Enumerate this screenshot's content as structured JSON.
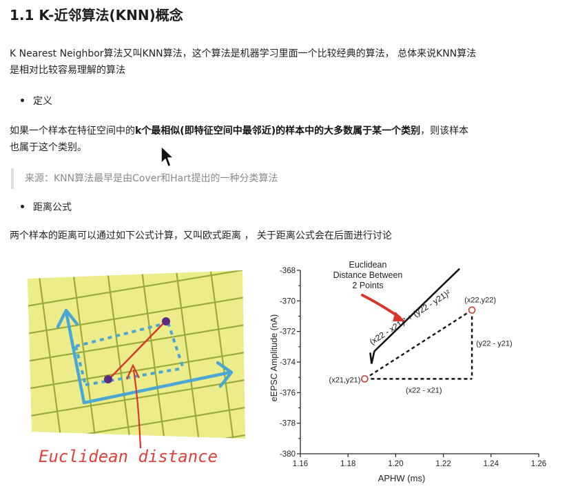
{
  "heading": "1.1 K-近邻算法(KNN)概念",
  "intro_line1": "K Nearest Neighbor算法又叫KNN算法，这个算法是机器学习里面一个比较经典的算法， 总体来说KNN算法",
  "intro_line2": "是相对比较容易理解的算法",
  "bullet_definition": "定义",
  "definition": {
    "prefix": "如果一个样本在特征空间中的",
    "bold": "k个最相似(即特征空间中最邻近)的样本中的大多数属于某一个类别",
    "suffix": "，则该样本",
    "line2": "也属于这个类别。"
  },
  "quote": "来源：KNN算法最早是由Cover和Hart提出的一种分类算法",
  "bullet_distance": "距离公式",
  "distance_text": "两个样本的距离可以通过如下公式计算，又叫欧式距离 ， 关于距离公式会在后面进行讨论",
  "left_figure": {
    "caption": "Euclidean distance",
    "colors": {
      "paper": "#ecec8a",
      "grid": "#9aab3a",
      "axis": "#4aa6d4",
      "line": "#d8362b",
      "point": "#5b2b7f",
      "caption": "#e0403a"
    }
  },
  "chart_data": {
    "type": "scatter",
    "title": "Euclidean Distance Between 2 Points",
    "xlabel": "APHW (ms)",
    "ylabel": "eEPSC Amplitude (nA)",
    "xlim": [
      1.16,
      1.26
    ],
    "ylim": [
      -380,
      -368
    ],
    "xticks": [
      "1.16",
      "1.18",
      "1.20",
      "1.22",
      "1.24",
      "1.26"
    ],
    "yticks": [
      "-368",
      "-370",
      "-372",
      "-374",
      "-376",
      "-378",
      "-380"
    ],
    "points": [
      {
        "label": "(x21,y21)",
        "x": 1.187,
        "y": -375.1
      },
      {
        "label": "(x22,y22)",
        "x": 1.232,
        "y": -370.6
      }
    ],
    "formula": "(x22 - x21)² + (y22 - y21)²",
    "dx_label": "(x22 - x21)",
    "dy_label": "(y22 - y21)",
    "grid": false
  }
}
